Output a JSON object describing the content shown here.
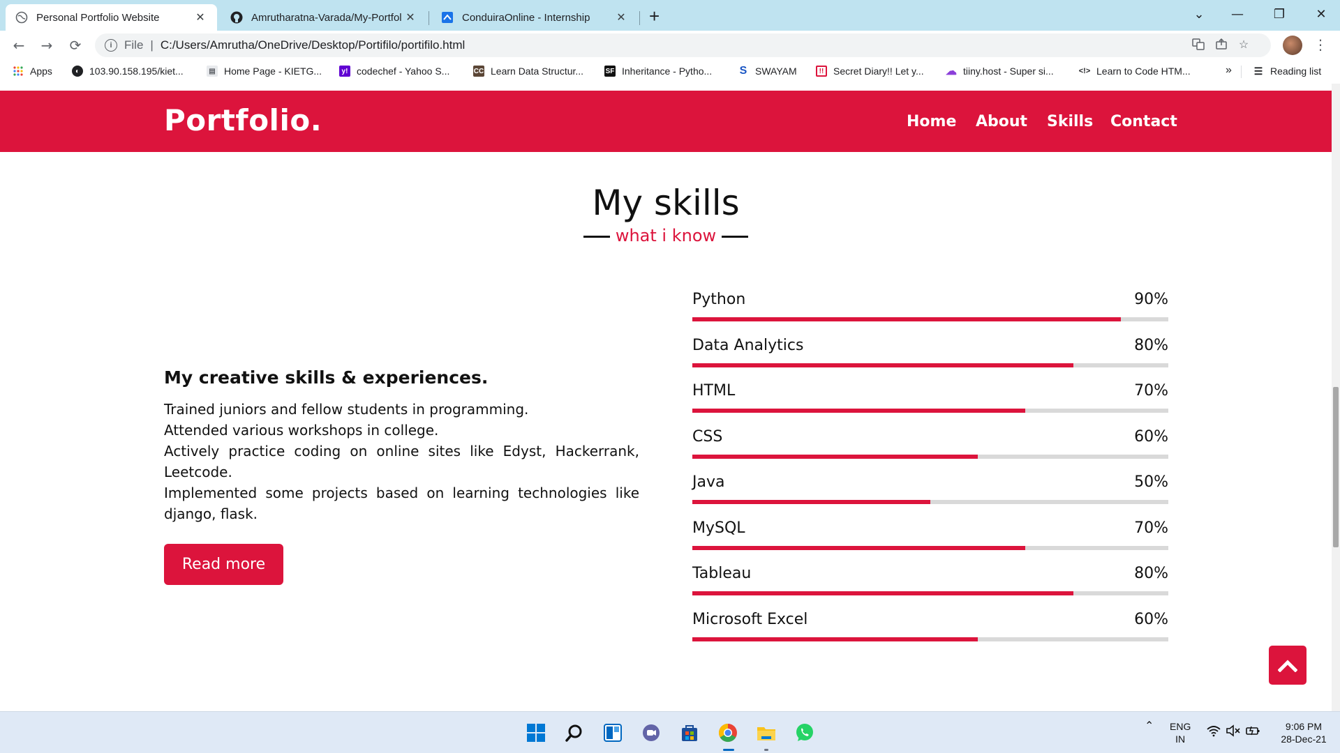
{
  "browser": {
    "tabs": [
      {
        "title": "Personal Portfolio Website",
        "active": true,
        "icon": "globe-icon"
      },
      {
        "title": "Amrutharatna-Varada/My-Portfol",
        "active": false,
        "icon": "github-icon"
      },
      {
        "title": "ConduiraOnline - Internship",
        "active": false,
        "icon": "conduira-icon"
      }
    ],
    "address": {
      "scheme_label": "File",
      "url": "C:/Users/Amrutha/OneDrive/Desktop/Portifilo/portifilo.html"
    },
    "bookmarks": [
      {
        "label": "Apps",
        "icon": "apps-grid-icon"
      },
      {
        "label": "103.90.158.195/kiet...",
        "icon": "globe-icon"
      },
      {
        "label": "Home Page - KIETG...",
        "icon": "page-icon"
      },
      {
        "label": "codechef - Yahoo S...",
        "icon": "yahoo-icon"
      },
      {
        "label": "Learn Data Structur...",
        "icon": "cc-icon"
      },
      {
        "label": "Inheritance - Pytho...",
        "icon": "sf-icon"
      },
      {
        "label": "SWAYAM",
        "icon": "swayam-icon"
      },
      {
        "label": "Secret Diary!! Let y...",
        "icon": "diary-icon"
      },
      {
        "label": "tiiny.host - Super si...",
        "icon": "tiiny-icon"
      },
      {
        "label": "Learn to Code HTM...",
        "icon": "code-icon"
      }
    ],
    "bookmarks_more": "»",
    "reading_list": "Reading list"
  },
  "site": {
    "logo": "Portfolio.",
    "nav": [
      "Home",
      "About",
      "Skills",
      "Contact"
    ],
    "section_title": "My skills",
    "section_subtitle": "what i know",
    "creative_heading": "My creative skills & experiences.",
    "creative_lines": [
      "Trained juniors and fellow students in programming.",
      "Attended various workshops in college.",
      "Actively practice coding on online sites like Edyst, Hackerrank, Leetcode.",
      "Implemented some projects based on learning technologies like django, flask."
    ],
    "read_more": "Read more",
    "skills": [
      {
        "name": "Python",
        "percent_label": "90%",
        "level": 0.9
      },
      {
        "name": "Data Analytics",
        "percent_label": "80%",
        "level": 0.8
      },
      {
        "name": "HTML",
        "percent_label": "70%",
        "level": 0.7
      },
      {
        "name": "CSS",
        "percent_label": "60%",
        "level": 0.6
      },
      {
        "name": "Java",
        "percent_label": "50%",
        "level": 0.5
      },
      {
        "name": "MySQL",
        "percent_label": "70%",
        "level": 0.7
      },
      {
        "name": "Tableau",
        "percent_label": "80%",
        "level": 0.8
      },
      {
        "name": "Microsoft Excel",
        "percent_label": "60%",
        "level": 0.6
      }
    ],
    "accent_color": "#dc143c"
  },
  "taskbar": {
    "apps": [
      "windows-start-icon",
      "search-icon",
      "widgets-icon",
      "teams-chat-icon",
      "store-icon",
      "chrome-icon",
      "file-explorer-icon",
      "whatsapp-icon"
    ],
    "lang_top": "ENG",
    "lang_bottom": "IN",
    "time": "9:06 PM",
    "date": "28-Dec-21"
  }
}
